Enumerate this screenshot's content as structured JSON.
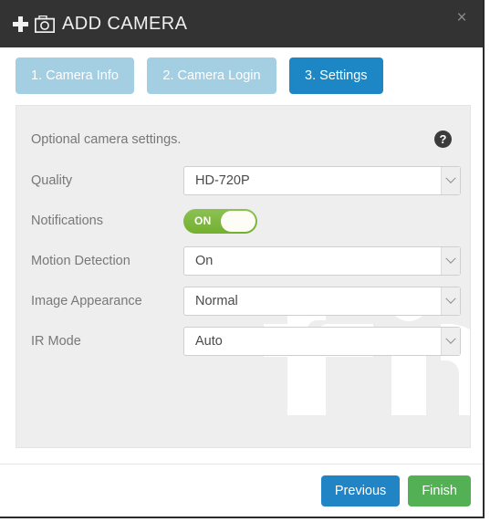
{
  "header": {
    "title": "ADD CAMERA",
    "plus_icon": "plus-icon",
    "camera_icon": "camera-icon",
    "close_label": "×",
    "background_color": "#333333"
  },
  "tabs": [
    {
      "label": "1. Camera Info",
      "active": false
    },
    {
      "label": "2. Camera Login",
      "active": false
    },
    {
      "label": "3. Settings",
      "active": true
    }
  ],
  "panel": {
    "intro_text": "Optional camera settings.",
    "help_icon_label": "?",
    "rows": [
      {
        "label": "Quality",
        "control": "select",
        "value": "HD-720P"
      },
      {
        "label": "Notifications",
        "control": "toggle",
        "value": "ON"
      },
      {
        "label": "Motion Detection",
        "control": "select",
        "value": "On"
      },
      {
        "label": "Image Appearance",
        "control": "select",
        "value": "Normal"
      },
      {
        "label": "IR Mode",
        "control": "select",
        "value": "Auto"
      }
    ]
  },
  "footer": {
    "previous_label": "Previous",
    "finish_label": "Finish"
  },
  "colors": {
    "header_bg": "#333333",
    "tab_inactive": "#a4cee2",
    "tab_active": "#1c87c4",
    "panel_bg": "#eeeeee",
    "toggle_on": "#7cb943",
    "previous_button": "#2185c5",
    "finish_button": "#54b054"
  }
}
